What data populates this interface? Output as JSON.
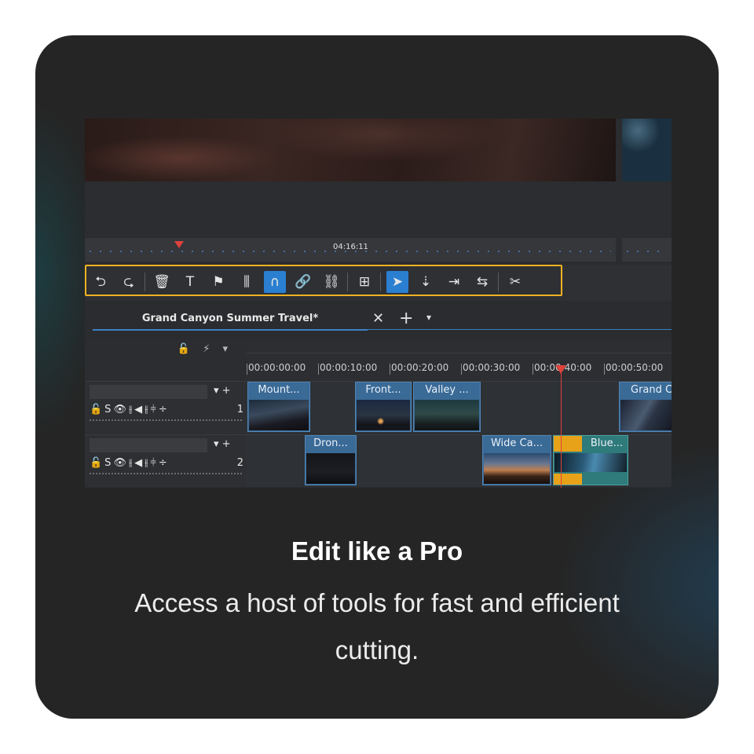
{
  "marketing": {
    "headline": "Edit like a Pro",
    "subtitle": "Access a host of tools for fast and efficient cutting."
  },
  "ruler": {
    "current_time": "04:16:11"
  },
  "toolbar": {
    "tools": [
      {
        "name": "undo-icon",
        "glyph": "⮌"
      },
      {
        "name": "redo-icon",
        "glyph": "⮎"
      },
      {
        "name": "delete-icon",
        "glyph": "🗑"
      },
      {
        "name": "title-icon",
        "glyph": "T"
      },
      {
        "name": "marker-flag-icon",
        "glyph": "⚑"
      },
      {
        "name": "audio-mixer-icon",
        "glyph": "⫼"
      },
      {
        "name": "magnet-snap-icon",
        "glyph": "∩",
        "active": true
      },
      {
        "name": "link-icon",
        "glyph": "🔗"
      },
      {
        "name": "unlink-icon",
        "glyph": "⛓"
      },
      {
        "name": "insert-icon",
        "glyph": "⊞"
      },
      {
        "name": "select-arrow-icon",
        "glyph": "➤",
        "active": true
      },
      {
        "name": "ripple-icon",
        "glyph": "⇣"
      },
      {
        "name": "trim-icon",
        "glyph": "⇥"
      },
      {
        "name": "slip-icon",
        "glyph": "⇆"
      },
      {
        "name": "cut-scissors-icon",
        "glyph": "✂"
      }
    ]
  },
  "project": {
    "tab_label": "Grand Canyon Summer Travel*",
    "close_glyph": "✕",
    "add_glyph": "+",
    "menu_glyph": "▾"
  },
  "timeline": {
    "header_icons": "🔓 ⚡ ▾",
    "timecodes": [
      "00:00:00:00",
      "00:00:10:00",
      "00:00:20:00",
      "00:00:30:00",
      "00:00:40:00",
      "00:00:50:00"
    ],
    "tracks": [
      {
        "number": "1",
        "controls": "▾ +",
        "icons": "🔓S👁⫲◀⫲⫩÷",
        "clips": [
          {
            "title": "Mount..."
          },
          {
            "title": "Front..."
          },
          {
            "title": "Valley ..."
          },
          {
            "title": "Grand C"
          }
        ]
      },
      {
        "number": "2",
        "controls": "▾ +",
        "icons": "🔓S👁⫲◀⫲⫩÷",
        "clips": [
          {
            "title": "Dron..."
          },
          {
            "title": "Wide Ca..."
          },
          {
            "title": "Blue..."
          }
        ]
      }
    ]
  }
}
